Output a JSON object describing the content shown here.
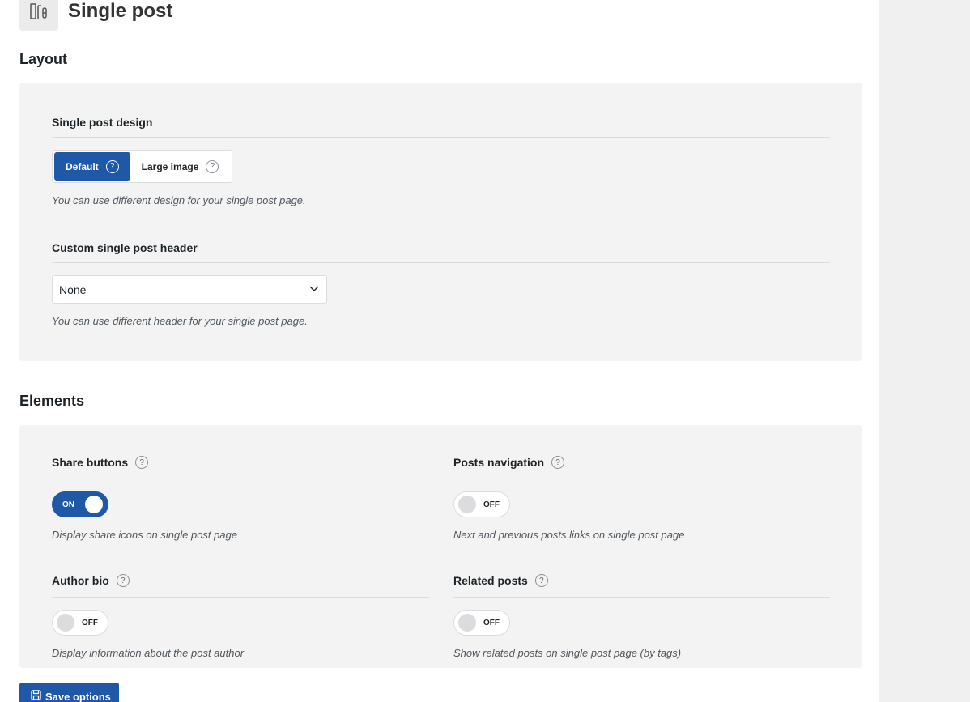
{
  "page": {
    "title": "Single post",
    "icon": "single-post-layout-icon"
  },
  "layout_section": {
    "title": "Layout",
    "single_post_design": {
      "label": "Single post design",
      "options": [
        {
          "label": "Default",
          "selected": true
        },
        {
          "label": "Large image",
          "selected": false
        }
      ],
      "help": "You can use different design for your single post page."
    },
    "custom_header": {
      "label": "Custom single post header",
      "value": "None",
      "help": "You can use different header for your single post page."
    }
  },
  "elements_section": {
    "title": "Elements",
    "share_buttons": {
      "label": "Share buttons",
      "state": "ON",
      "help": "Display share icons on single post page"
    },
    "posts_navigation": {
      "label": "Posts navigation",
      "state": "OFF",
      "help": "Next and previous posts links on single post page"
    },
    "author_bio": {
      "label": "Author bio",
      "state": "OFF",
      "help": "Display information about the post author"
    },
    "related_posts": {
      "label": "Related posts",
      "state": "OFF",
      "help": "Show related posts on single post page (by tags)"
    }
  },
  "save_button": {
    "label": "Save options",
    "icon": "save-icon"
  },
  "colors": {
    "accent": "#1e58a6",
    "panel_bg": "#f3f3f3",
    "rail_bg": "#f0f0f1"
  }
}
